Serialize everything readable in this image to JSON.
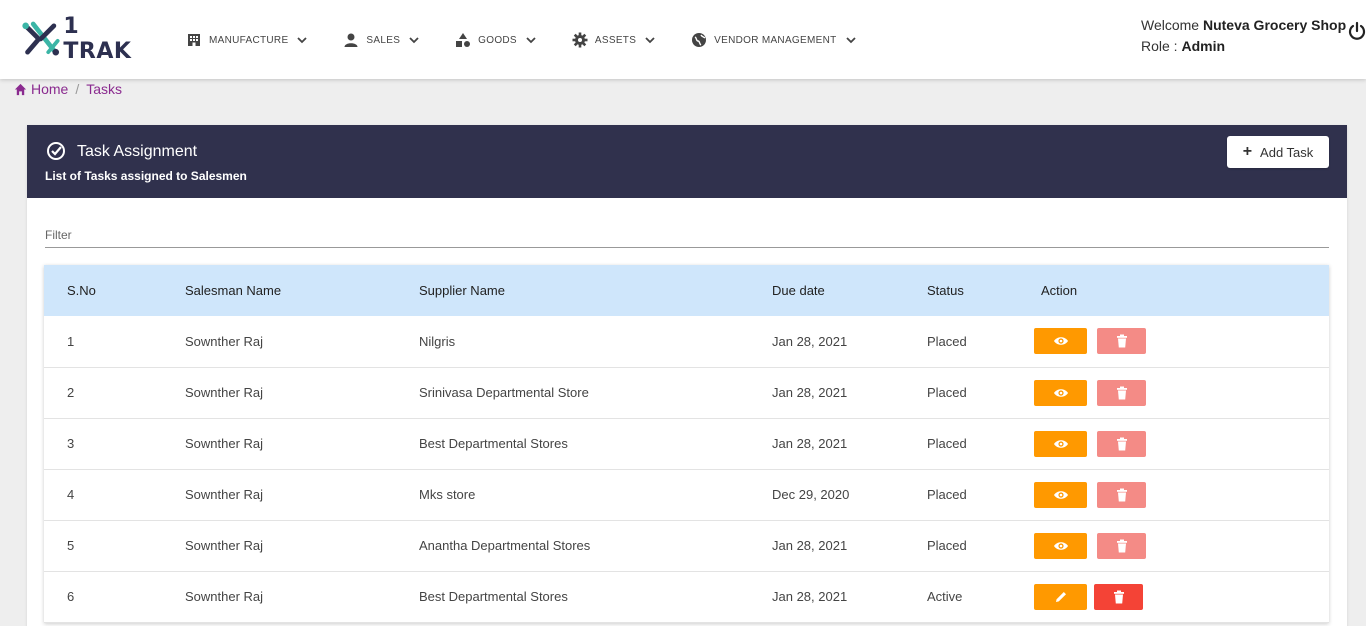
{
  "brand": {
    "name": "1 TRAK"
  },
  "nav": [
    {
      "label": "MANUFACTURE",
      "icon": "building-icon"
    },
    {
      "label": "SALES",
      "icon": "user-icon"
    },
    {
      "label": "GOODS",
      "icon": "shapes-icon"
    },
    {
      "label": "ASSETS",
      "icon": "gear-icon"
    },
    {
      "label": "VENDOR MANAGEMENT",
      "icon": "globe-icon"
    }
  ],
  "user": {
    "welcome_prefix": "Welcome",
    "shop": "Nuteva Grocery Shop",
    "role_prefix": "Role :",
    "role": "Admin"
  },
  "breadcrumb": {
    "home": "Home",
    "separator": "/",
    "current": "Tasks"
  },
  "card": {
    "title": "Task Assignment",
    "subtitle": "List of Tasks assigned to Salesmen",
    "add_label": "Add Task"
  },
  "filter": {
    "placeholder": "Filter",
    "value": ""
  },
  "table": {
    "headers": [
      "S.No",
      "Salesman Name",
      "Supplier Name",
      "Due date",
      "Status",
      "Action"
    ],
    "rows": [
      {
        "sno": "1",
        "salesman": "Sownther Raj",
        "supplier": "Nilgris",
        "due": "Jan 28, 2021",
        "status": "Placed",
        "editable": false
      },
      {
        "sno": "2",
        "salesman": "Sownther Raj",
        "supplier": "Srinivasa Departmental Store",
        "due": "Jan 28, 2021",
        "status": "Placed",
        "editable": false
      },
      {
        "sno": "3",
        "salesman": "Sownther Raj",
        "supplier": "Best Departmental Stores",
        "due": "Jan 28, 2021",
        "status": "Placed",
        "editable": false
      },
      {
        "sno": "4",
        "salesman": "Sownther Raj",
        "supplier": "Mks store",
        "due": "Dec 29, 2020",
        "status": "Placed",
        "editable": false
      },
      {
        "sno": "5",
        "salesman": "Sownther Raj",
        "supplier": "Anantha Departmental Stores",
        "due": "Jan 28, 2021",
        "status": "Placed",
        "editable": false
      },
      {
        "sno": "6",
        "salesman": "Sownther Raj",
        "supplier": "Best Departmental Stores",
        "due": "Jan 28, 2021",
        "status": "Active",
        "editable": true
      }
    ]
  },
  "colors": {
    "header_bg": "#30314d",
    "table_head_bg": "#cfe6fb",
    "view_btn": "#ff9900",
    "delete_disabled": "#f48b86",
    "delete_active": "#f44336",
    "breadcrumb_link": "#8a2a8f"
  }
}
